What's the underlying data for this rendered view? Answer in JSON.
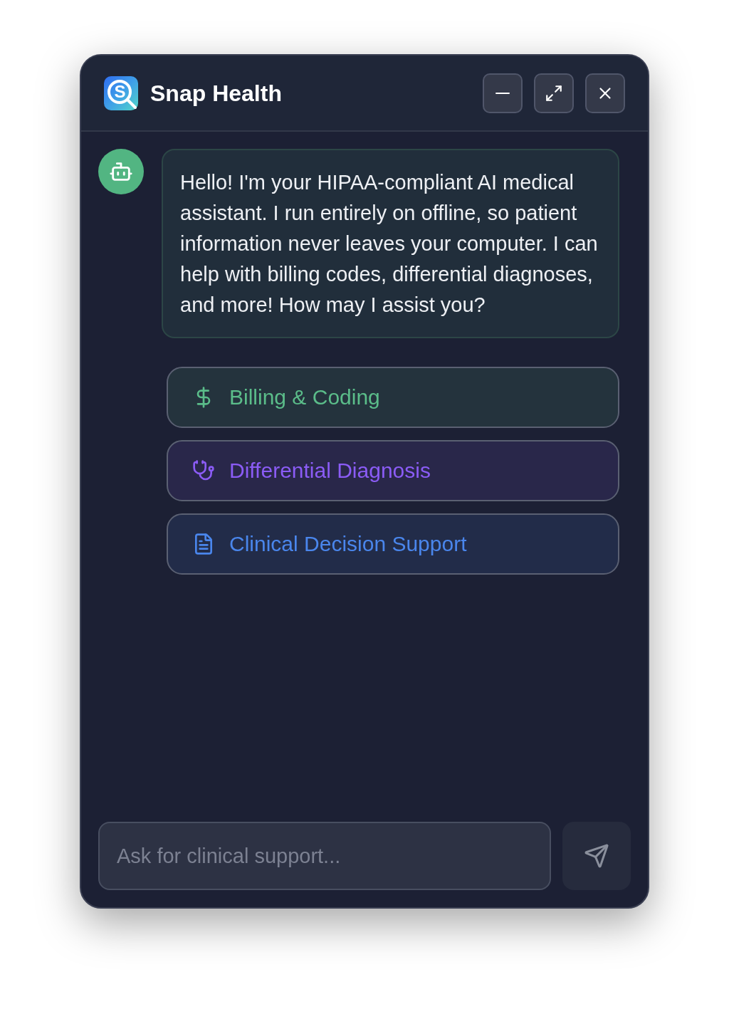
{
  "window": {
    "title": "Snap Health",
    "logo_letter": "S"
  },
  "messages": [
    {
      "kind": "assistant",
      "text": "Hello! I'm your HIPAA-compliant AI medical assistant. I run entirely on offline, so patient information never leaves your computer. I can help with billing codes, differential diagnoses, and more! How may I assist you?"
    }
  ],
  "quick_actions": [
    {
      "kind": "billing",
      "label": "Billing & Coding",
      "color": "#5bbd8a"
    },
    {
      "kind": "diagnosis",
      "label": "Differential Diagnosis",
      "color": "#8b5cf6"
    },
    {
      "kind": "support",
      "label": "Clinical Decision Support",
      "color": "#4a86ec"
    }
  ],
  "composer": {
    "placeholder": "Ask for clinical support..."
  }
}
